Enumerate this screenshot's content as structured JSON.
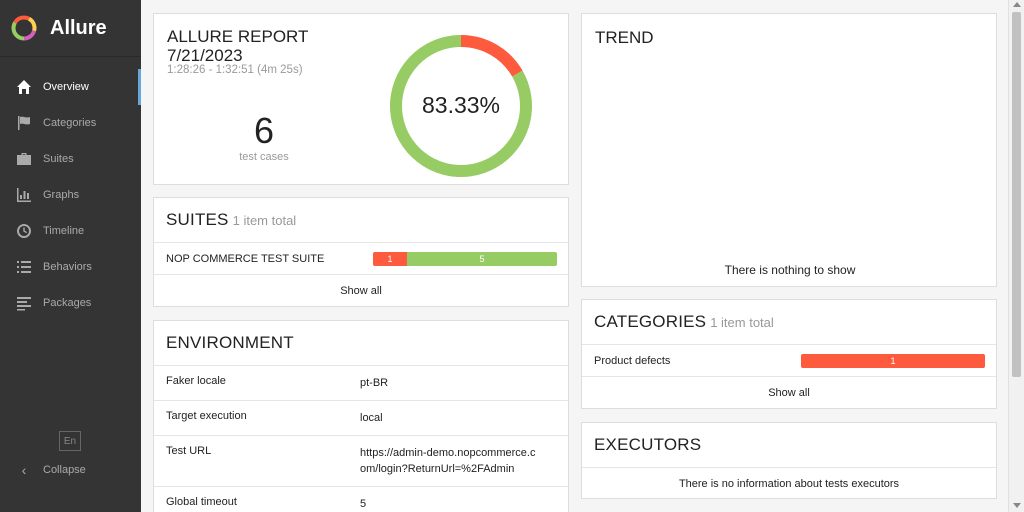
{
  "app": {
    "name": "Allure"
  },
  "sidebar": {
    "items": [
      {
        "label": "Overview",
        "icon": "home-icon",
        "active": true
      },
      {
        "label": "Categories",
        "icon": "flag-icon",
        "active": false
      },
      {
        "label": "Suites",
        "icon": "briefcase-icon",
        "active": false
      },
      {
        "label": "Graphs",
        "icon": "bar-chart-icon",
        "active": false
      },
      {
        "label": "Timeline",
        "icon": "clock-icon",
        "active": false
      },
      {
        "label": "Behaviors",
        "icon": "list-icon",
        "active": false
      },
      {
        "label": "Packages",
        "icon": "align-left-icon",
        "active": false
      }
    ],
    "language": "En",
    "collapse_label": "Collapse"
  },
  "summary": {
    "title": "ALLURE REPORT",
    "date": "7/21/2023",
    "time": "1:28:26 - 1:32:51 (4m 25s)",
    "test_count": "6",
    "test_count_label": "test cases",
    "percent": "83.33%",
    "passed_fraction": 0.8333,
    "colors": {
      "passed": "#97cc64",
      "failed": "#fd5a3e"
    }
  },
  "suites": {
    "title": "SUITES",
    "subtitle": "1 item total",
    "rows": [
      {
        "name": "NOP COMMERCE TEST SUITE",
        "failed": "1",
        "passed": "5"
      }
    ],
    "show_all": "Show all"
  },
  "environment": {
    "title": "ENVIRONMENT",
    "rows": [
      {
        "key": "Faker locale",
        "value": "pt-BR"
      },
      {
        "key": "Target execution",
        "value": "local"
      },
      {
        "key": "Test URL",
        "value": "https://admin-demo.nopcommerce.com/login?ReturnUrl=%2FAdmin"
      },
      {
        "key": "Global timeout",
        "value": "5"
      }
    ]
  },
  "trend": {
    "title": "TREND",
    "empty": "There is nothing to show"
  },
  "categories": {
    "title": "CATEGORIES",
    "subtitle": "1 item total",
    "rows": [
      {
        "name": "Product defects",
        "count": "1"
      }
    ],
    "show_all": "Show all"
  },
  "executors": {
    "title": "EXECUTORS",
    "empty": "There is no information about tests executors"
  }
}
